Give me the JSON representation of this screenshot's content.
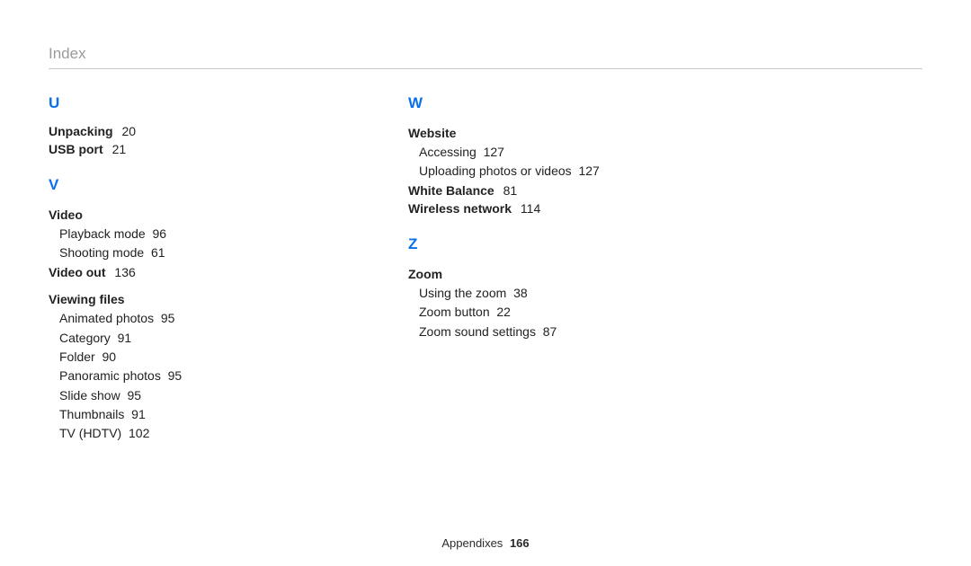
{
  "header": "Index",
  "footer": {
    "section": "Appendixes",
    "page": "166"
  },
  "col1": {
    "U": {
      "letter": "U",
      "unpacking": {
        "label": "Unpacking",
        "page": "20"
      },
      "usbport": {
        "label": "USB port",
        "page": "21"
      }
    },
    "V": {
      "letter": "V",
      "video": {
        "label": "Video",
        "playback": {
          "label": "Playback mode",
          "page": "96"
        },
        "shooting": {
          "label": "Shooting mode",
          "page": "61"
        }
      },
      "videoout": {
        "label": "Video out",
        "page": "136"
      },
      "viewing": {
        "label": "Viewing files",
        "animated": {
          "label": "Animated photos",
          "page": "95"
        },
        "category": {
          "label": "Category",
          "page": "91"
        },
        "folder": {
          "label": "Folder",
          "page": "90"
        },
        "panoramic": {
          "label": "Panoramic photos",
          "page": "95"
        },
        "slideshow": {
          "label": "Slide show",
          "page": "95"
        },
        "thumbs": {
          "label": "Thumbnails",
          "page": "91"
        },
        "tv": {
          "label": "TV (HDTV)",
          "page": "102"
        }
      }
    }
  },
  "col2": {
    "W": {
      "letter": "W",
      "website": {
        "label": "Website",
        "accessing": {
          "label": "Accessing",
          "page": "127"
        },
        "uploading": {
          "label": "Uploading photos or videos",
          "page": "127"
        }
      },
      "whitebalance": {
        "label": "White Balance",
        "page": "81"
      },
      "wireless": {
        "label": "Wireless network",
        "page": "114"
      }
    },
    "Z": {
      "letter": "Z",
      "zoom": {
        "label": "Zoom",
        "using": {
          "label": "Using the zoom",
          "page": "38"
        },
        "button": {
          "label": "Zoom button",
          "page": "22"
        },
        "sound": {
          "label": "Zoom sound settings",
          "page": "87"
        }
      }
    }
  }
}
